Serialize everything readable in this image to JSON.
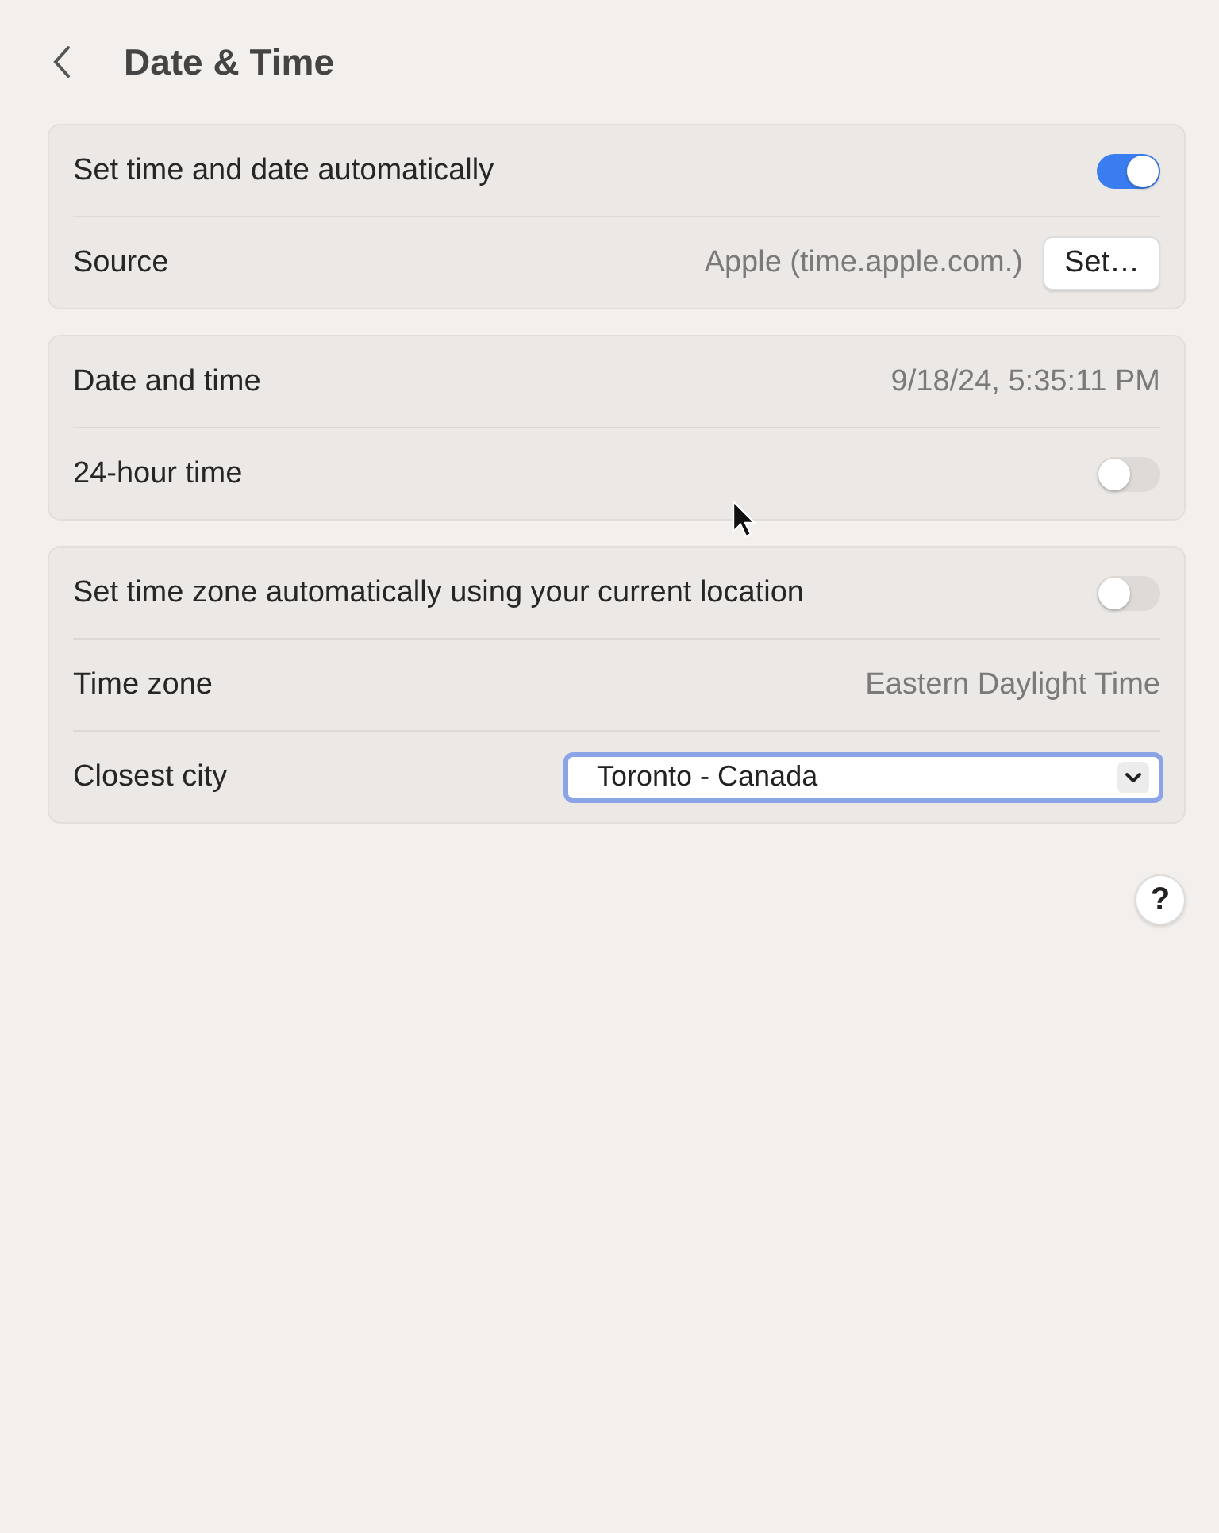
{
  "header": {
    "title": "Date & Time"
  },
  "sections": [
    {
      "rows": [
        {
          "kind": "toggle",
          "label": "Set time and date automatically",
          "on": true
        },
        {
          "kind": "value_button",
          "label": "Source",
          "value": "Apple (time.apple.com.)",
          "button": "Set…"
        }
      ]
    },
    {
      "rows": [
        {
          "kind": "value",
          "label": "Date and time",
          "value": "9/18/24, 5:35:11 PM"
        },
        {
          "kind": "toggle",
          "label": "24-hour time",
          "on": false
        }
      ]
    },
    {
      "rows": [
        {
          "kind": "toggle",
          "label": "Set time zone automatically using your current location",
          "on": false
        },
        {
          "kind": "value",
          "label": "Time zone",
          "value": "Eastern Daylight Time"
        },
        {
          "kind": "select",
          "label": "Closest city",
          "value": "Toronto - Canada",
          "focused": true
        }
      ]
    }
  ],
  "help": "?"
}
